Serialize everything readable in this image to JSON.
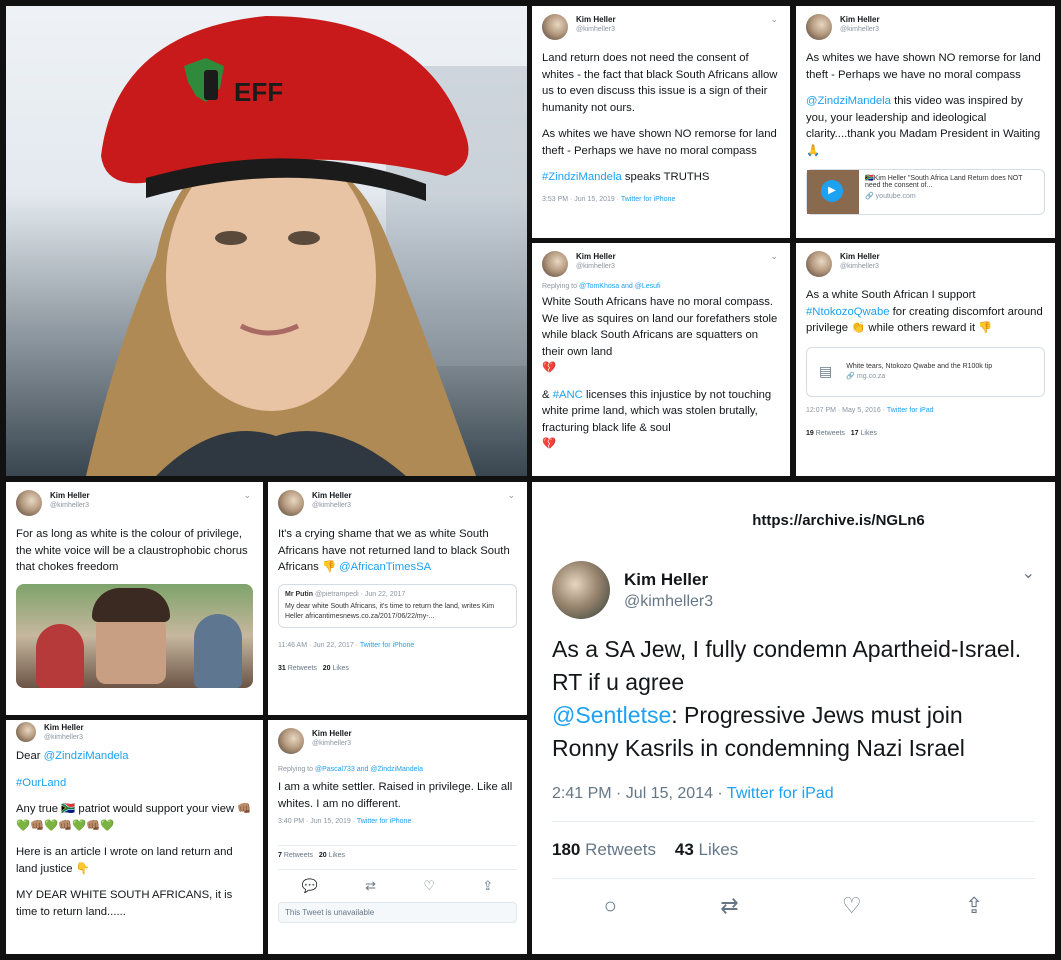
{
  "profile": {
    "name": "Kim Heller",
    "handle": "@kimheller3"
  },
  "beret": {
    "text": "EFF"
  },
  "tweet1": {
    "p1": "Land return does not need the consent of whites - the fact that black South Africans allow us to even discuss this issue is a sign of their humanity not ours.",
    "p2": "As whites we have shown NO remorse for land theft - Perhaps we have no moral compass",
    "tag": "#ZindziMandela",
    "tag_rest": " speaks TRUTHS",
    "time": "3:53 PM · Jun 15, 2019 · ",
    "client": "Twitter for iPhone"
  },
  "tweet2": {
    "p1": "As whites we have shown NO remorse for land theft - Perhaps we have no moral compass",
    "mention": "@ZindziMandela",
    "p2_rest": " this video was inspired by you, your leadership and ideological clarity....thank you Madam President in Waiting 🙏",
    "card_title": "🇿🇦Kim Heller \"South Africa Land Return does NOT need the consent of...",
    "card_domain": "youtube.com"
  },
  "tweet3": {
    "reply": "Replying to ",
    "reply_to": "@TomKhosa and @Lesufi",
    "p1": "White South Africans have no moral compass. We live as squires on land our forefathers stole while black South Africans are squatters on their own land",
    "p2_pre": "& ",
    "p2_tag": "#ANC",
    "p2_rest": " licenses this injustice by not touching white prime land, which was stolen brutally, fracturing black life & soul",
    "heart": "💔"
  },
  "tweet4": {
    "p1_pre": "As a white South African I support ",
    "tag": "#NtokozoQwabe",
    "p1_rest": " for creating discomfort around privilege 👏 while others reward it 👎",
    "card_title": "White tears, Ntokozo Qwabe and the R100k tip",
    "card_domain": "mg.co.za",
    "time": "12:07 PM · May 5, 2016 · ",
    "client": "Twitter for iPad",
    "retweets": "19",
    "retweets_label": " Retweets",
    "likes": "17",
    "likes_label": " Likes"
  },
  "tweet5": {
    "p1": "For as long as white is the colour of privilege, the white voice will be a claustrophobic chorus that chokes freedom"
  },
  "tweet6": {
    "p1": "It's a crying shame that we as white South Africans have not returned land to black South Africans 👎 ",
    "mention": "@AfricanTimesSA",
    "q_name": "Mr Putin",
    "q_handle": " @pietrampedi · Jun 22, 2017",
    "q_text": "My dear white South Africans, it's time to return the land, writes Kim Heller africantimesnews.co.za/2017/06/22/my-...",
    "time": "11:46 AM · Jun 22, 2017 · ",
    "client": "Twitter for iPhone",
    "retweets": "31",
    "retweets_label": " Retweets",
    "likes": "20",
    "likes_label": " Likes"
  },
  "tweet7": {
    "p1_pre": "Dear ",
    "mention": "@ZindziMandela",
    "tag": "#OurLand",
    "p2": "Any true 🇿🇦 patriot would support your view 👊🏽💚👊🏽💚👊🏽💚👊🏽💚",
    "p3": "Here is an article I wrote on land return and land justice 👇",
    "p4": "MY DEAR WHITE SOUTH AFRICANS, it is time to return land......"
  },
  "tweet8": {
    "reply": "Replying to ",
    "reply_to": "@Pascal733 and @ZindziMandela",
    "p1": "I am a white settler. Raised in privilege. Like all whites. I am no different.",
    "time": "3:40 PM · Jun 15, 2019 · ",
    "client": "Twitter for iPhone",
    "retweets": "7",
    "retweets_label": " Retweets",
    "likes": "20",
    "likes_label": " Likes",
    "unavailable": "This Tweet is unavailable"
  },
  "tweet9": {
    "archive": "https://archive.is/NGLn6",
    "text": "As a SA Jew, I fully condemn Apartheid-Israel. RT if u agree",
    "mention": "@Sentletse",
    "text_rest": ": Progressive Jews must join Ronny Kasrils in condemning Nazi Israel",
    "time": "2:41 PM · Jul 15, 2014 · ",
    "client": "Twitter for iPad",
    "retweets": "180",
    "retweets_label": " Retweets",
    "likes": "43",
    "likes_label": " Likes"
  },
  "colors": {
    "link": "#1da1f2",
    "beret": "#c81a1a",
    "background": "#111111"
  }
}
